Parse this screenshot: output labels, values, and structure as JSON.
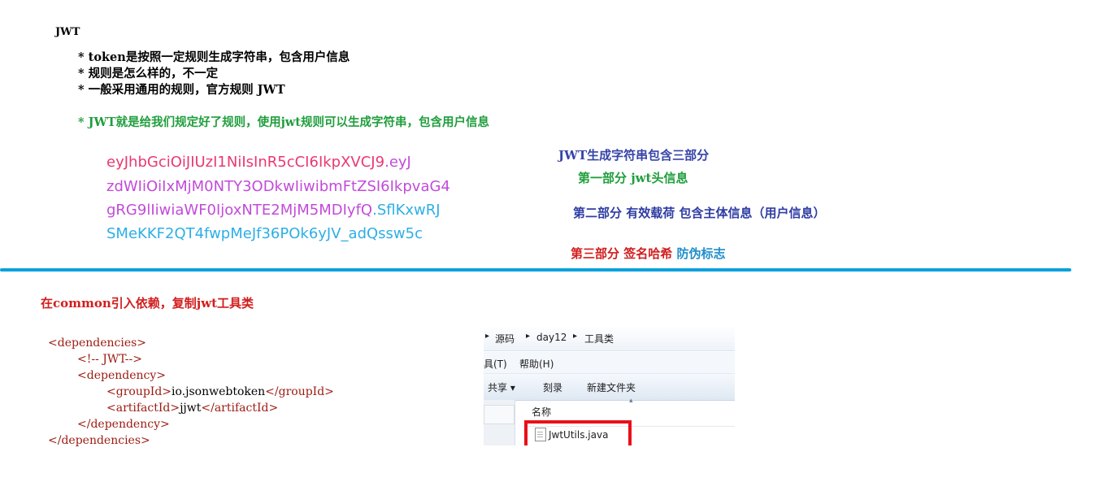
{
  "notes": {
    "title": "JWT",
    "bullets": [
      "* token是按照一定规则生成字符串，包含用户信息",
      "* 规则是怎么样的，不一定",
      "* 一般采用通用的规则，官方规则 JWT"
    ],
    "highlight_bullet": "* JWT就是给我们规定好了规则，使用jwt规则可以生成字符串，包含用户信息"
  },
  "token_sample": {
    "line1_header": "eyJhbGciOiJIUzI1NiIsInR5cCI6IkpXVCJ9",
    "line1_dot": ".",
    "line1_payload": "eyJ",
    "line2_payload": "zdWIiOiIxMjM0NTY3ODkwIiwibmFtZSI6IkpvaG4",
    "line3_payload": "gRG9lIiwiaWF0IjoxNTE2MjM5MDIyfQ",
    "line3_dot": ".",
    "line3_sig": "SflKxwRJ",
    "line4_sig": "SMeKKF2QT4fwpMeJf36POk6yJV_adQssw5c"
  },
  "parts": {
    "heading": "JWT生成字符串包含三部分",
    "first": "第一部分 jwt头信息",
    "second": "第二部分 有效载荷 包含主体信息（用户信息）",
    "third_a": "第三部分 签名哈希 ",
    "third_b": "防伪标志"
  },
  "dependency_note": "在common引入依赖，复制jwt工具类",
  "xml": {
    "line1": "<dependencies>",
    "line2": "<!-- JWT-->",
    "line3": "<dependency>",
    "line4_open": "<groupId>",
    "line4_text": "io.jsonwebtoken",
    "line4_close": "</groupId>",
    "line5_open": "<artifactId>",
    "line5_text": "jjwt",
    "line5_close": "</artifactId>",
    "line6": "</dependency>",
    "line7": "</dependencies>"
  },
  "explorer": {
    "breadcrumb": [
      "源码",
      "day12",
      "工具类"
    ],
    "menu": [
      "具(T)",
      "帮助(H)"
    ],
    "toolbar": [
      "共享 ▾",
      "刻录",
      "新建文件夹"
    ],
    "column_header": "名称",
    "file_name": "JwtUtils.java"
  },
  "colors": {
    "jwt_header": "#ea3870",
    "jwt_payload": "#c24bd9",
    "jwt_signature": "#2eaee6",
    "divider": "#0aa0dc",
    "highlight_box": "#e8101a"
  }
}
